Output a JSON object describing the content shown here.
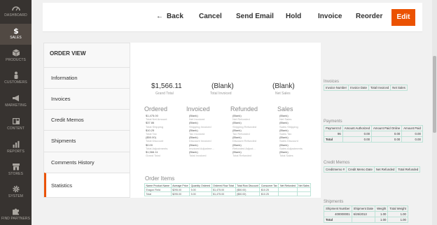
{
  "sidebar": {
    "items": [
      {
        "label": "Dashboard",
        "icon": "dashboard-icon"
      },
      {
        "label": "Sales",
        "icon": "dollar-icon",
        "active": true
      },
      {
        "label": "Products",
        "icon": "cube-icon"
      },
      {
        "label": "Customers",
        "icon": "person-icon"
      },
      {
        "label": "Marketing",
        "icon": "megaphone-icon"
      },
      {
        "label": "Content",
        "icon": "layout-icon"
      },
      {
        "label": "Reports",
        "icon": "bar-chart-icon"
      },
      {
        "label": "Stores",
        "icon": "store-icon"
      },
      {
        "label": "System",
        "icon": "gear-icon"
      },
      {
        "label": "Find Partners",
        "icon": "puzzle-icon"
      }
    ]
  },
  "toolbar": {
    "back": "Back",
    "cancel": "Cancel",
    "send_email": "Send Email",
    "hold": "Hold",
    "invoice": "Invoice",
    "reorder": "Reorder",
    "edit": "Edit"
  },
  "order_view": {
    "title": "ORDER VIEW",
    "tabs": [
      "Information",
      "Invoices",
      "Credit Memos",
      "Shipments",
      "Comments History",
      "Statistics"
    ],
    "active_tab": "Statistics"
  },
  "kpis": [
    {
      "value": "$1,566.11",
      "label": "Grand Total"
    },
    {
      "value": "(Blank)",
      "label": "Total Invoiced"
    },
    {
      "value": "(Blank)",
      "label": "Net Sales"
    }
  ],
  "columns": {
    "ordered": {
      "title": "Ordered",
      "rows": [
        [
          "$1,475.00",
          "Total Net Amount"
        ],
        [
          "$37.86",
          "Total Shipping"
        ],
        [
          "$10.25",
          "Total Tax"
        ],
        [
          "($50.00)",
          "Total Discount"
        ],
        [
          "$0.00",
          "Total Adjustments"
        ],
        [
          "$1,566.11",
          "Grand Total"
        ]
      ]
    },
    "invoiced": {
      "title": "Invoiced",
      "rows": [
        [
          "(Blank)",
          "Net Invoiced"
        ],
        [
          "(Blank)",
          "Shipping Invoiced"
        ],
        [
          "(Blank)",
          "Tax Invoiced"
        ],
        [
          "(Blank)",
          "Discount Invoiced"
        ],
        [
          "(Blank)",
          "Invoiced Adjustme..."
        ],
        [
          "(Blank)",
          "Total Invoiced"
        ]
      ]
    },
    "refunded": {
      "title": "Refunded",
      "rows": [
        [
          "(Blank)",
          "Net Refunded"
        ],
        [
          "(Blank)",
          "Shipping Refunded"
        ],
        [
          "(Blank)",
          "Tax Refunded"
        ],
        [
          "(Blank)",
          "Discount Refunded"
        ],
        [
          "(Blank)",
          "Refunded Adjust..."
        ],
        [
          "(Blank)",
          "Total Refunded"
        ]
      ]
    },
    "sales": {
      "title": "Sales",
      "rows": [
        [
          "(Blank)",
          "Net Sales"
        ],
        [
          "(Blank)",
          "Sales Shipping"
        ],
        [
          "(Blank)",
          "Sales Tax"
        ],
        [
          "(Blank)",
          "Sales Discount"
        ],
        [
          "(Blank)",
          "Sales Adjustments"
        ],
        [
          "(Blank)",
          "Total Sales"
        ]
      ]
    }
  },
  "order_items": {
    "title": "Order Items",
    "headers": [
      "Name Product Name",
      "Average Price",
      "Quantity Ordered",
      "Ordered Row Total",
      "Total Row Discount",
      "Consumer Tax",
      "Net Refunded",
      "Net Sales"
    ],
    "rows": [
      [
        "Eragon Field",
        "$295.00",
        "5.00",
        "$1,475.00",
        "($50.00)",
        "$10.25",
        "",
        ""
      ],
      [
        "Total",
        "$295.00",
        "5.00",
        "$1,475.00",
        "($50.00)",
        "$10.25",
        "",
        ""
      ]
    ]
  },
  "invoices": {
    "title": "Invoices",
    "headers": [
      "Invoice Number",
      "Invoice Date",
      "Total Invoiced",
      "Net Sales"
    ]
  },
  "payments": {
    "title": "Payments",
    "headers": [
      "Payment Id",
      "Amount Authorized",
      "Amount Paid Online",
      "Amount Paid"
    ],
    "rows": [
      [
        "96",
        "0.00",
        "0.00",
        "0.00"
      ],
      [
        "Total",
        "0.00",
        "0.00",
        "0.00"
      ]
    ]
  },
  "credit_memos": {
    "title": "Credit Memos",
    "headers": [
      "Creditmemo #",
      "Credit Memo Date",
      "Net Refunded",
      "Total Refunded"
    ]
  },
  "shipments": {
    "title": "Shipments",
    "headers": [
      "Shipment Number",
      "Shipment Date",
      "Weight",
      "Total Weight"
    ],
    "rows": [
      [
        "400000001",
        "6/26/2013",
        "1.00",
        "1.00"
      ],
      [
        "Total",
        "",
        "1.00",
        "1.00"
      ]
    ]
  }
}
